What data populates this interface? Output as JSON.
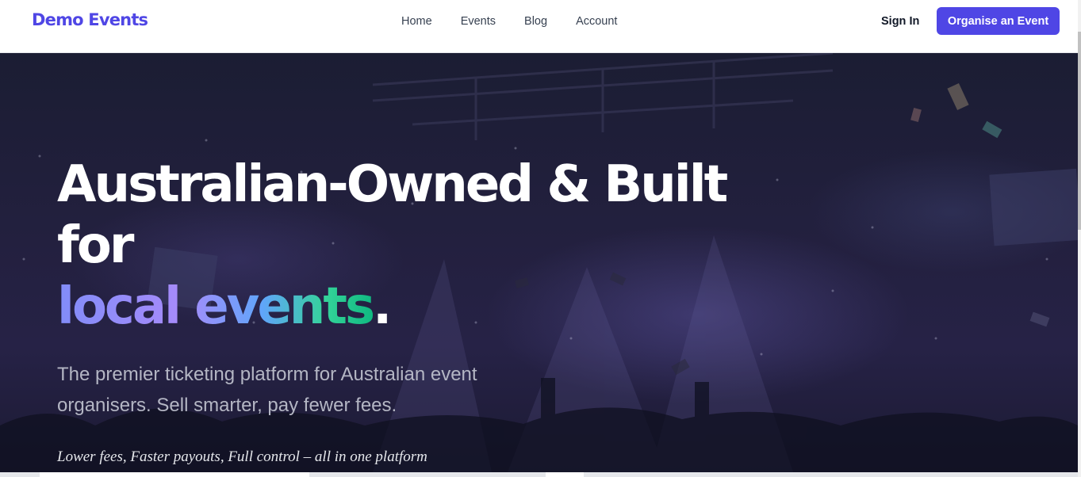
{
  "brand": {
    "name": "Demo Events",
    "color": "#4f46e5"
  },
  "nav": {
    "links": [
      {
        "label": "Home"
      },
      {
        "label": "Events"
      },
      {
        "label": "Blog"
      },
      {
        "label": "Account"
      }
    ],
    "sign_in": "Sign In",
    "cta": "Organise an Event"
  },
  "hero": {
    "headline_line1": "Australian-Owned & Built",
    "headline_line2": "for",
    "headline_accent": "local events",
    "headline_period": ".",
    "subtitle": "The premier ticketing platform for Australian event organisers. Sell smarter, pay fewer fees.",
    "tagline": "Lower fees, Faster payouts, Full control – all in one platform",
    "background_image": "concert-crowd-confetti",
    "accent_gradient": [
      "#818cf8",
      "#a78bfa",
      "#60a5fa",
      "#34d399"
    ]
  }
}
